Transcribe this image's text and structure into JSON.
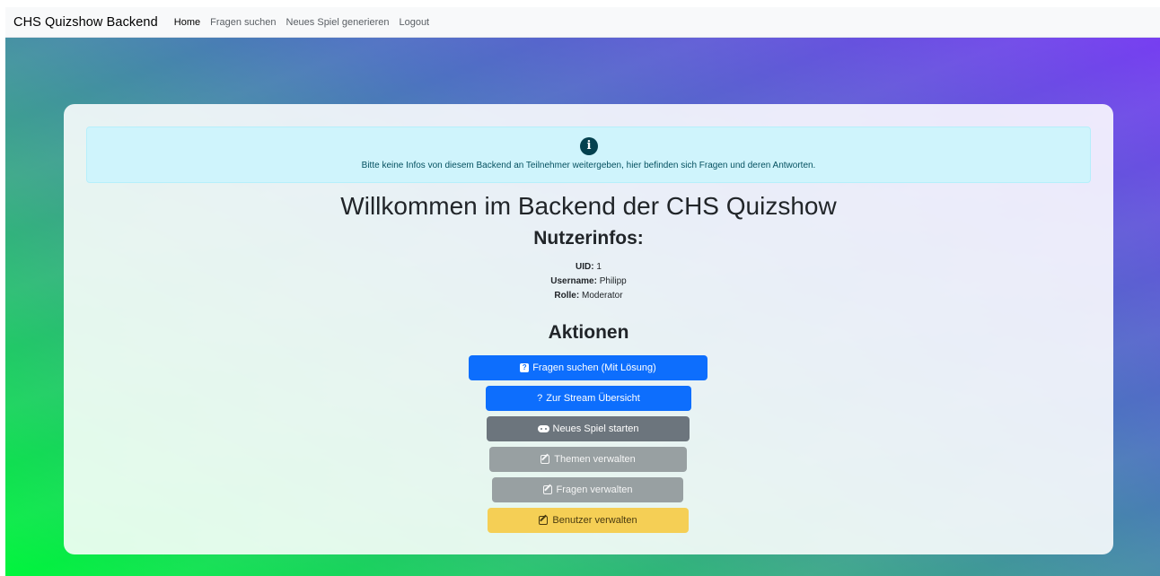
{
  "navbar": {
    "brand": "CHS Quizshow Backend",
    "links": [
      "Home",
      "Fragen suchen",
      "Neues Spiel generieren",
      "Logout"
    ]
  },
  "alert": {
    "icon": "info-circle-icon",
    "text": "Bitte keine Infos von diesem Backend an Teilnehmer weitergeben, hier befinden sich Fragen und deren Antworten."
  },
  "main": {
    "title": "Willkommen im Backend der CHS Quizshow",
    "user_section_title": "Nutzerinfos:",
    "user": {
      "uid_label": "UID:",
      "uid": "1",
      "username_label": "Username:",
      "username": "Philipp",
      "role_label": "Rolle:",
      "role": "Moderator"
    },
    "actions_title": "Aktionen",
    "actions": [
      {
        "label": "Fragen suchen (Mit Lösung)",
        "icon": "question-square-icon",
        "color": "#0d6efd"
      },
      {
        "label": "Zur Stream Übersicht",
        "icon": "question-icon",
        "color": "#0d6efd"
      },
      {
        "label": "Neues Spiel starten",
        "icon": "gamepad-icon",
        "color": "#6c757d"
      },
      {
        "label": "Themen verwalten",
        "icon": "edit-icon",
        "color": "#98a0a2"
      },
      {
        "label": "Fragen verwalten",
        "icon": "edit-icon",
        "color": "#98a0a2"
      },
      {
        "label": "Benutzer verwalten",
        "icon": "edit-icon",
        "color": "#f5cf55"
      }
    ]
  }
}
